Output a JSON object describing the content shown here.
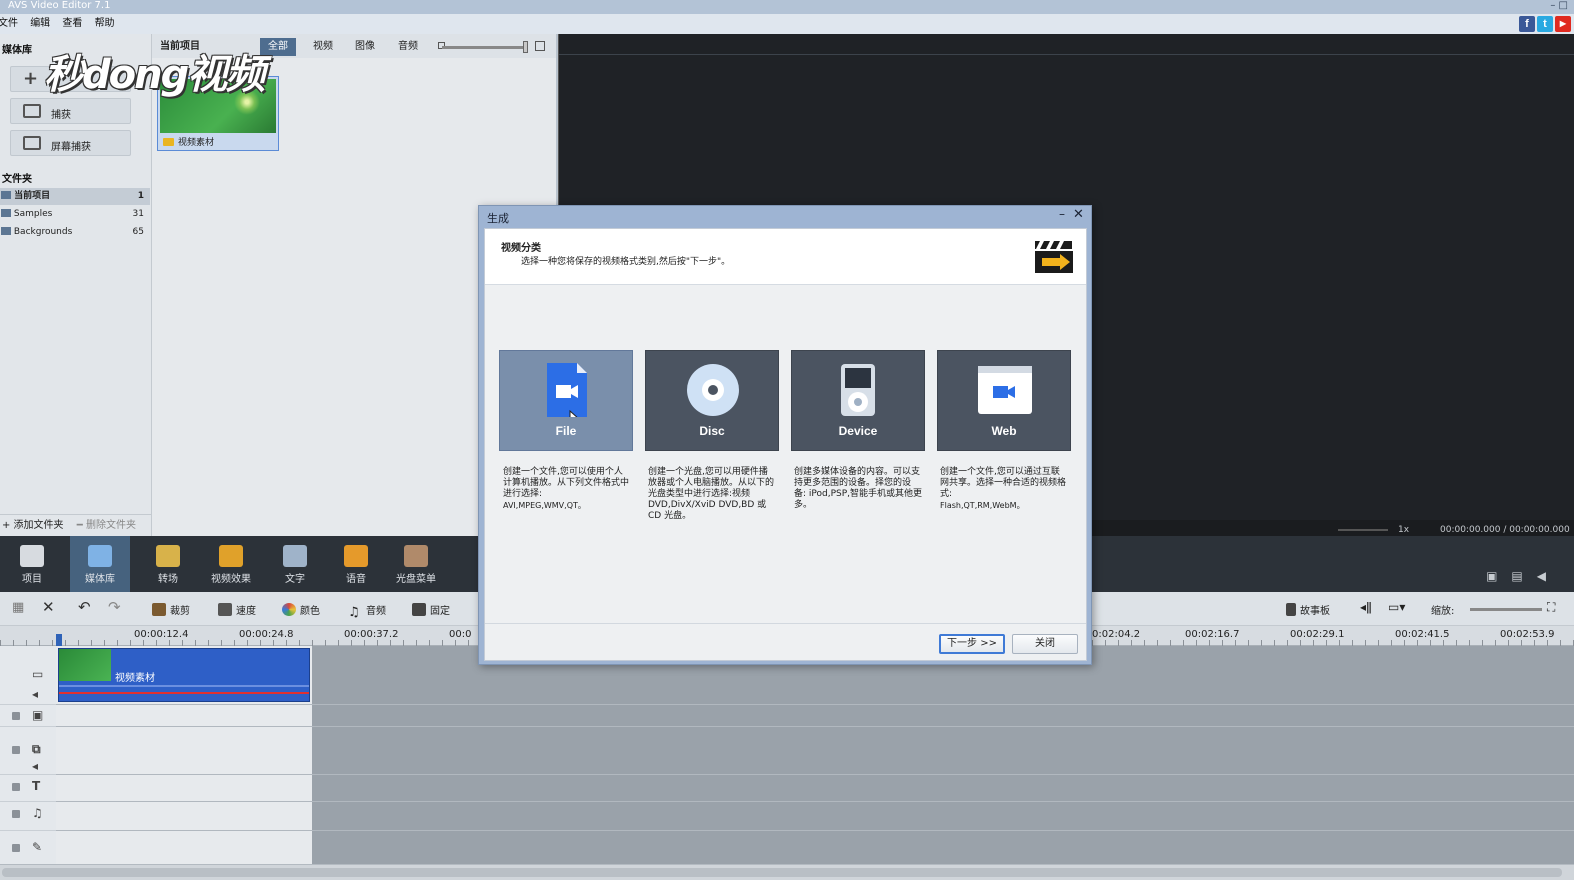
{
  "app": {
    "title": "AVS Video Editor 7.1",
    "window_controls": "– □"
  },
  "menu": [
    "文件",
    "编辑",
    "查看",
    "帮助"
  ],
  "social": [
    {
      "icon": "facebook-icon",
      "glyph": "f",
      "color": "#3b5998"
    },
    {
      "icon": "twitter-icon",
      "glyph": "t",
      "color": "#29a9e1"
    },
    {
      "icon": "youtube-icon",
      "glyph": "▶",
      "color": "#e02a20"
    }
  ],
  "watermark": "秒dong视频",
  "library": {
    "title": "媒体库",
    "add_label": "+",
    "capture_label": "捕获",
    "screen_capture_label": "屏幕捕获",
    "folders_title": "文件夹",
    "folders": [
      {
        "name": "当前项目",
        "count": "1",
        "selected": true
      },
      {
        "name": "Samples",
        "count": "31",
        "selected": false
      },
      {
        "name": "Backgrounds",
        "count": "65",
        "selected": false
      }
    ],
    "add_folder": "+ 添加文件夹",
    "delete_folder": "━ 删除文件夹"
  },
  "media": {
    "project_label": "当前项目",
    "tabs": [
      {
        "label": "全部",
        "active": true
      },
      {
        "label": "视频",
        "active": false
      },
      {
        "label": "图像",
        "active": false
      },
      {
        "label": "音频",
        "active": false
      }
    ],
    "item_name": "视频素材"
  },
  "preview": {
    "speed": "1x",
    "time": "00:00:00.000 / 00:00:00.000"
  },
  "toolbar": [
    {
      "label": "项目",
      "icon": "clapper-icon",
      "color": "#d7dbe0",
      "active": false
    },
    {
      "label": "媒体库",
      "icon": "media-library-icon",
      "color": "#7fb2e5",
      "active": true
    },
    {
      "label": "转场",
      "icon": "transition-icon",
      "color": "#d8b24a",
      "active": false
    },
    {
      "label": "视频效果",
      "icon": "video-effects-icon",
      "color": "#e0a12a",
      "active": false
    },
    {
      "label": "文字",
      "icon": "text-icon",
      "color": "#9fb3c9",
      "active": false
    },
    {
      "label": "语音",
      "icon": "microphone-icon",
      "color": "#e59a2b",
      "active": false
    },
    {
      "label": "光盘菜单",
      "icon": "disc-menu-icon",
      "color": "#b08a6a",
      "active": false
    }
  ],
  "edit_tools": [
    {
      "label": "裁剪",
      "icon": "trim-icon",
      "color": "#7b5a30"
    },
    {
      "label": "速度",
      "icon": "speed-icon",
      "color": "#555"
    },
    {
      "label": "颜色",
      "icon": "color-icon",
      "color": "#d9483b"
    },
    {
      "label": "音频",
      "icon": "audio-note-icon",
      "color": "#444"
    },
    {
      "label": "固定",
      "icon": "freeze-frame-icon",
      "color": "#444"
    }
  ],
  "storyboard_label": "故事板",
  "zoom_label": "缩放:",
  "ruler_ticks": [
    "00:00:12.4",
    "00:00:24.8",
    "00:00:37.2",
    "00:0",
    "0:02:04.2",
    "00:02:16.7",
    "00:02:29.1",
    "00:02:41.5",
    "00:02:53.9"
  ],
  "timeline": {
    "clip_name": "视频素材"
  },
  "dialog": {
    "title": "生成",
    "heading": "视频分类",
    "subtitle": "选择一种您将保存的视频格式类别,然后按\"下一步\"。",
    "categories": [
      {
        "name": "File",
        "icon": "file-video-icon",
        "selected": true,
        "desc": "创建一个文件,您可以使用个人计算机播放。从下列文件格式中进行选择:",
        "formats": "AVI,MPEG,WMV,QT。"
      },
      {
        "name": "Disc",
        "icon": "disc-icon",
        "selected": false,
        "desc": "创建一个光盘,您可以用硬件播放器或个人电脑播放。从以下的光盘类型中进行选择:视频 DVD,DivX/XviD DVD,BD 或 CD 光盘。",
        "formats": ""
      },
      {
        "name": "Device",
        "icon": "media-player-device-icon",
        "selected": false,
        "desc": "创建多媒体设备的内容。可以支持更多范围的设备。择您的设备: iPod,PSP,智能手机或其他更多。",
        "formats": ""
      },
      {
        "name": "Web",
        "icon": "web-video-icon",
        "selected": false,
        "desc": "创建一个文件,您可以通过互联网共享。选择一种合适的视频格式:",
        "formats": "Flash,QT,RM,WebM。"
      }
    ],
    "next_label": "下一步 >>",
    "close_label": "关闭"
  }
}
